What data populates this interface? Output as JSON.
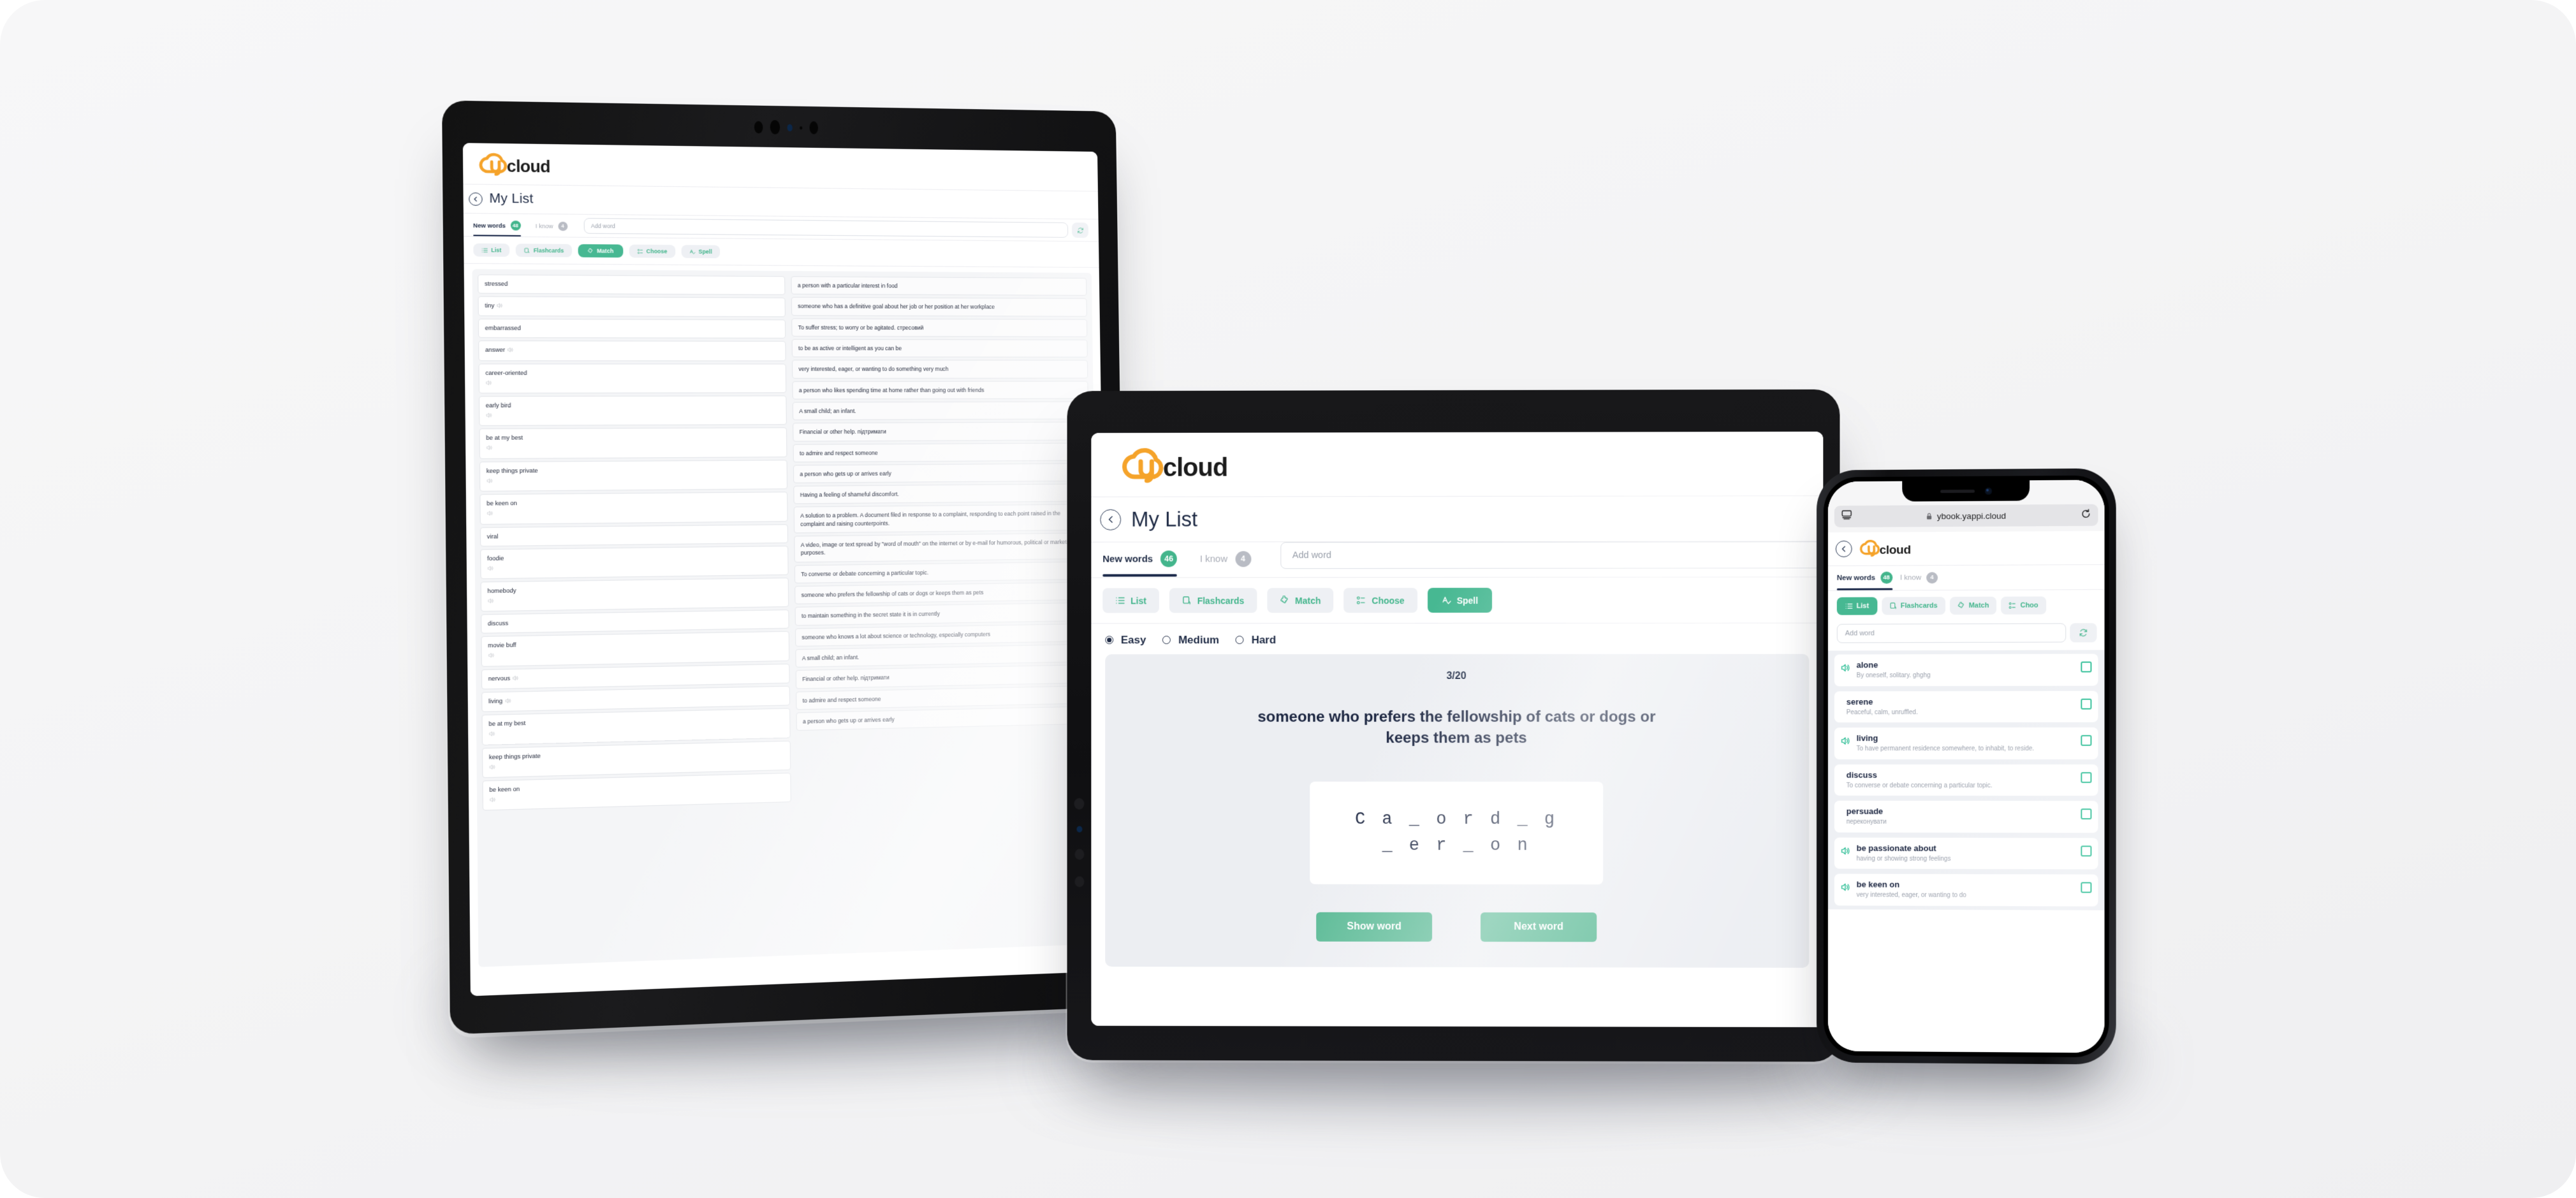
{
  "brand": {
    "name": "ycloud",
    "logo_mark_color": "#f5a32a",
    "logo_text_color": "#1b1b1b",
    "accent_green": "#43b58c",
    "accent_dark": "#1d2b4b"
  },
  "page": {
    "title": "My List",
    "back_icon": "chevron-left-icon"
  },
  "tablet": {
    "tabs": {
      "new_words_label": "New words",
      "new_words_count": "48",
      "i_know_label": "I know",
      "i_know_count": "4"
    },
    "add_word_placeholder": "Add word",
    "refresh_icon": "refresh-icon",
    "modes": [
      {
        "label": "List",
        "icon": "list-icon",
        "active": false
      },
      {
        "label": "Flashcards",
        "icon": "flashcards-icon",
        "active": false
      },
      {
        "label": "Match",
        "icon": "puzzle-icon",
        "active": true
      },
      {
        "label": "Choose",
        "icon": "choose-icon",
        "active": false
      },
      {
        "label": "Spell",
        "icon": "spell-icon",
        "active": false
      }
    ],
    "match_words": [
      {
        "word": "stressed",
        "speaker": false
      },
      {
        "word": "tiny",
        "speaker": "inline"
      },
      {
        "word": "embarrassed",
        "speaker": false
      },
      {
        "word": "answer",
        "speaker": "inline"
      },
      {
        "word": "career-oriented",
        "speaker": "block"
      },
      {
        "word": "early bird",
        "speaker": "block"
      },
      {
        "word": "be at my best",
        "speaker": "block"
      },
      {
        "word": "keep things private",
        "speaker": "block"
      },
      {
        "word": "be keen on",
        "speaker": "block"
      },
      {
        "word": "viral",
        "speaker": false
      },
      {
        "word": "foodie",
        "speaker": "block"
      },
      {
        "word": "homebody",
        "speaker": "block"
      },
      {
        "word": "discuss",
        "speaker": false
      },
      {
        "word": "movie buff",
        "speaker": "block"
      },
      {
        "word": "nervous",
        "speaker": "inline"
      },
      {
        "word": "living",
        "speaker": "inline"
      },
      {
        "word": "be at my best",
        "speaker": "block"
      },
      {
        "word": "keep things private",
        "speaker": "block"
      },
      {
        "word": "be keen on",
        "speaker": "block"
      }
    ],
    "match_definitions": [
      "a person with a particular interest in food",
      "someone who has a definitive goal about her job or her position at her workplace",
      "To suffer stress; to worry or be agitated. стресовий",
      "to be as active or intelligent as you can be",
      "very interested, eager, or wanting to do something very much",
      "a person who likes spending time at home rather than going out with friends",
      "A small child; an infant.",
      "Financial or other help. підтримати",
      "to admire and respect someone",
      "a person who gets up or arrives early",
      "Having a feeling of shameful discomfort.",
      "A solution to a problem. A document filed in response to a complaint, responding to each point raised in the complaint and raising counterpoints.",
      "A video, image or text spread by \"word of mouth\" on the internet or by e-mail for humorous, political or marketing purposes.",
      "To converse or debate concerning a particular topic.",
      "someone who prefers the fellowship of cats or dogs or keeps them as pets",
      "to maintain something in the secret state it is in currently",
      "someone who knows a lot about science or technology, especially computers",
      "A small child; an infant.",
      "Financial or other help. підтримати",
      "to admire and respect someone",
      "a person who gets up or arrives early"
    ]
  },
  "laptop": {
    "tabs": {
      "new_words_label": "New words",
      "new_words_count": "46",
      "i_know_label": "I know",
      "i_know_count": "4"
    },
    "add_word_placeholder": "Add word",
    "modes": [
      {
        "label": "List",
        "icon": "list-icon",
        "active": false
      },
      {
        "label": "Flashcards",
        "icon": "flashcards-icon",
        "active": false
      },
      {
        "label": "Match",
        "icon": "puzzle-icon",
        "active": false
      },
      {
        "label": "Choose",
        "icon": "choose-icon",
        "active": false
      },
      {
        "label": "Spell",
        "icon": "spell-icon",
        "active": true
      }
    ],
    "difficulty": [
      {
        "label": "Easy",
        "selected": true
      },
      {
        "label": "Medium",
        "selected": false
      },
      {
        "label": "Hard",
        "selected": false
      }
    ],
    "exercise": {
      "progress": "3/20",
      "definition": "someone who prefers the fellowship of cats or dogs or keeps them as pets",
      "masked_answer_line1": "C a _   o r   d _ g",
      "masked_answer_line2": "_ e r _ o n",
      "show_word_label": "Show word",
      "next_word_label": "Next word"
    }
  },
  "phone": {
    "browser": {
      "reader_icon": "reader-view-icon",
      "lock_icon": "lock-icon",
      "url": "ybook.yappi.cloud",
      "reload_icon": "reload-icon"
    },
    "tabs": {
      "new_words_label": "New words",
      "new_words_count": "48",
      "i_know_label": "I know",
      "i_know_count": "4"
    },
    "add_word_placeholder": "Add word",
    "refresh_icon": "refresh-icon",
    "modes": [
      {
        "label": "List",
        "icon": "list-icon",
        "active": true
      },
      {
        "label": "Flashcards",
        "icon": "flashcards-icon",
        "active": false
      },
      {
        "label": "Match",
        "icon": "puzzle-icon",
        "active": false
      },
      {
        "label": "Choo",
        "icon": "choose-icon",
        "active": false
      }
    ],
    "items": [
      {
        "word": "alone",
        "definition": "By oneself, solitary. ghghg",
        "speaker": true,
        "checked": false
      },
      {
        "word": "serene",
        "definition": "Peaceful, calm, unruffled.",
        "speaker": false,
        "checked": false
      },
      {
        "word": "living",
        "definition": "To have permanent residence somewhere, to inhabit, to reside.",
        "speaker": true,
        "checked": false
      },
      {
        "word": "discuss",
        "definition": "To converse or debate concerning a particular topic.",
        "speaker": false,
        "checked": false
      },
      {
        "word": "persuade",
        "definition": "переконувати",
        "speaker": false,
        "checked": false
      },
      {
        "word": "be passionate about",
        "definition": "having or showing strong feelings",
        "speaker": true,
        "checked": false
      },
      {
        "word": "be keen on",
        "definition": "very interested, eager, or wanting to do",
        "speaker": true,
        "checked": false
      }
    ]
  }
}
